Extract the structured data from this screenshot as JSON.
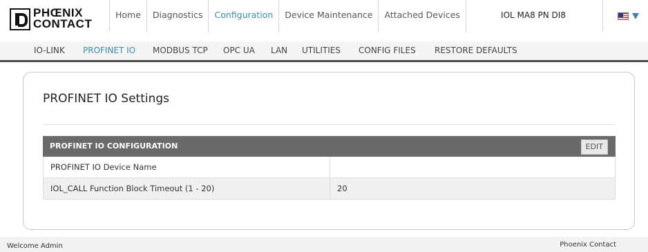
{
  "brand": {
    "line1": "PHŒNIX",
    "line2": "CONTACT"
  },
  "tabs": [
    {
      "label": "Home"
    },
    {
      "label": "Diagnostics"
    },
    {
      "label": "Configuration"
    },
    {
      "label": "Device Maintenance"
    },
    {
      "label": "Attached Devices"
    }
  ],
  "device_name": "IOL MA8 PN DI8",
  "language": {
    "icon": "us-flag-icon"
  },
  "subnav": [
    {
      "label": "IO-LINK"
    },
    {
      "label": "PROFINET IO"
    },
    {
      "label": "MODBUS TCP"
    },
    {
      "label": "OPC UA"
    },
    {
      "label": "LAN"
    },
    {
      "label": "UTILITIES"
    },
    {
      "label": "CONFIG FILES"
    },
    {
      "label": "RESTORE DEFAULTS"
    }
  ],
  "page_title": "PROFINET IO Settings",
  "config_table": {
    "header": "PROFINET IO CONFIGURATION",
    "edit_label": "EDIT",
    "rows": [
      {
        "label": "PROFINET IO Device Name",
        "value": ""
      },
      {
        "label": "IOL_CALL Function Block Timeout (1 - 20)",
        "value": "20"
      }
    ]
  },
  "footer": {
    "welcome": "Welcome Admin",
    "company": "Phoenix Contact"
  },
  "colors": {
    "accent": "#3a8ea8",
    "header_bar": "#6a6a6a",
    "subnav_border": "#4a4a4a"
  }
}
